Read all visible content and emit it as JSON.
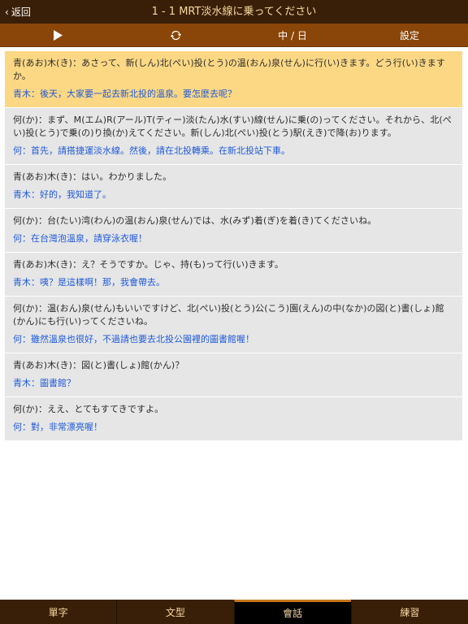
{
  "navbar": {
    "back_label": "返回",
    "title": "1 - 1 MRT淡水線に乗ってください"
  },
  "toolbar": {
    "play_icon": "▶",
    "refresh_icon": "refresh-icon",
    "language_label": "中 / 日",
    "settings_label": "設定"
  },
  "dialogue": [
    {
      "jp": "青(あお)木(き)：あさって、新(しん)北(ぺい)投(とう)の温(おん)泉(せん)に行(い)きます。どう行(い)きますか。",
      "zh": "青木：後天，大家要一起去新北投的溫泉。要怎麼去呢？"
    },
    {
      "jp": "何(か)：まず、M(エム)R(アール)T(ティー)淡(たん)水(すい)線(せん)に乗(の)ってください。それから、北(ぺい)投(とう)で乗(の)り換(か)えてください。新(しん)北(ぺい)投(とう)駅(えき)で降(お)ります。",
      "zh": "何：首先，請搭捷運淡水線。然後，請在北投轉乘。在新北投站下車。"
    },
    {
      "jp": "青(あお)木(き)：はい。わかりました。",
      "zh": "青木：好的，我知道了。"
    },
    {
      "jp": "何(か)：台(たい)湾(わん)の温(おん)泉(せん)では、水(みず)着(ぎ)を着(き)てくださいね。",
      "zh": "何：在台灣泡溫泉，請穿泳衣喔！"
    },
    {
      "jp": "青(あお)木(き)：え？そうですか。じゃ、持(も)って行(い)きます。",
      "zh": "青木：咦？是這樣啊！那，我會帶去。"
    },
    {
      "jp": "何(か)：温(おん)泉(せん)もいいですけど、北(ぺい)投(とう)公(こう)園(えん)の中(なか)の図(と)書(しょ)館(かん)にも行(い)ってくださいね。",
      "zh": "何：雖然溫泉也很好，不過請也要去北投公園裡的圖書館喔！"
    },
    {
      "jp": "青(あお)木(き)：図(と)書(しょ)館(かん)？",
      "zh": "青木：圖書館？"
    },
    {
      "jp": "何(か)：ええ、とてもすてきですよ。",
      "zh": "何：對，非常漂亮喔！"
    }
  ],
  "tabs": [
    {
      "label": "單字",
      "active": false
    },
    {
      "label": "文型",
      "active": false
    },
    {
      "label": "會話",
      "active": true
    },
    {
      "label": "練習",
      "active": false
    }
  ],
  "colors": {
    "navbar_bg": "#3a1f08",
    "toolbar_bg": "#8a4608",
    "active_row": "#fcd884",
    "chinese_text": "#1f5ad9",
    "tab_accent": "#c8761b"
  }
}
